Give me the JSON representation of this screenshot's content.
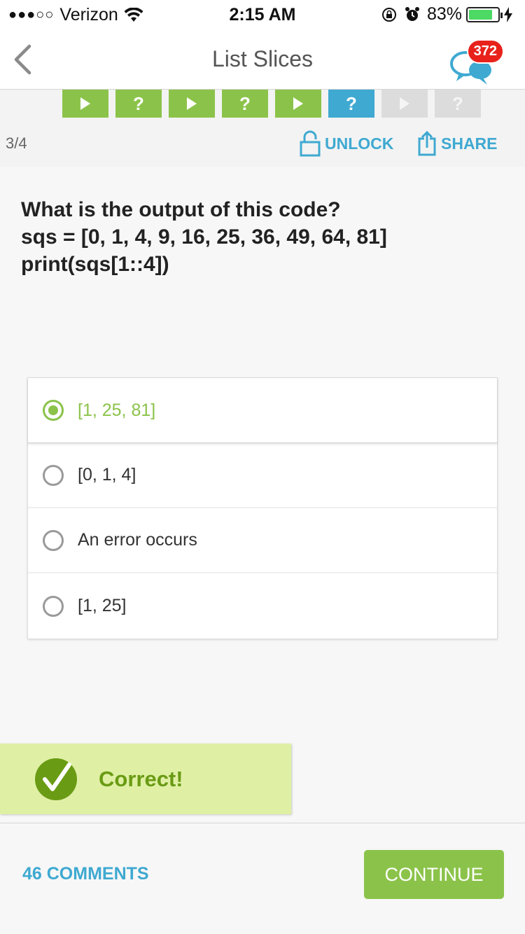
{
  "status_bar": {
    "signal": "●●●○○",
    "carrier": "Verizon",
    "time": "2:15 AM",
    "battery": "83%"
  },
  "nav": {
    "title": "List Slices",
    "comment_badge": "372"
  },
  "progress": {
    "steps": [
      {
        "type": "lesson",
        "state": "done"
      },
      {
        "type": "quiz",
        "state": "done"
      },
      {
        "type": "lesson",
        "state": "done"
      },
      {
        "type": "quiz",
        "state": "done"
      },
      {
        "type": "lesson",
        "state": "done"
      },
      {
        "type": "quiz",
        "state": "current"
      },
      {
        "type": "lesson",
        "state": "locked"
      },
      {
        "type": "quiz",
        "state": "locked"
      }
    ],
    "quiz_symbol": "?",
    "count": "3/4",
    "unlock_label": "UNLOCK",
    "share_label": "SHARE"
  },
  "question": {
    "lines": [
      "What is the output of this code?",
      "sqs = [0, 1, 4, 9, 16, 25, 36, 49, 64, 81]",
      "print(sqs[1::4])"
    ]
  },
  "options": [
    {
      "label": "[1, 25, 81]",
      "selected": true
    },
    {
      "label": "[0, 1, 4]",
      "selected": false
    },
    {
      "label": "An error occurs",
      "selected": false
    },
    {
      "label": "[1, 25]",
      "selected": false
    }
  ],
  "result": {
    "label": "Correct!"
  },
  "footer": {
    "comments_label": "46 COMMENTS",
    "continue_label": "CONTINUE"
  },
  "colors": {
    "accent_green": "#8bc34a",
    "accent_blue": "#3fa9d1",
    "badge_red": "#e8221b"
  }
}
